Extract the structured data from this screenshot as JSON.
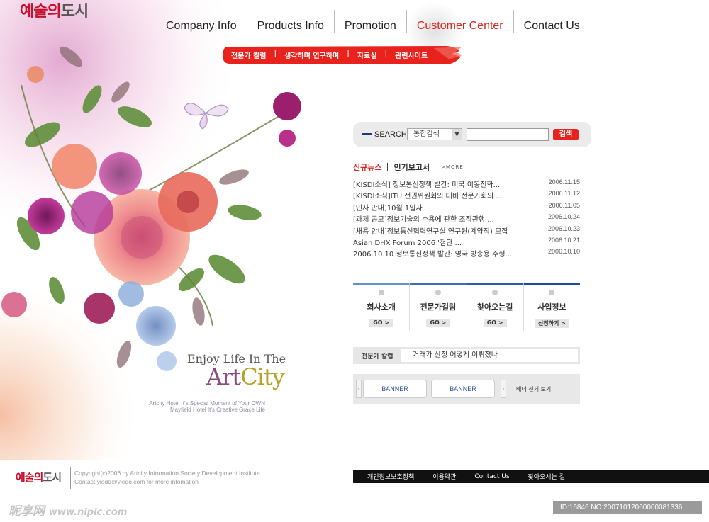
{
  "logo": {
    "part1": "예술의",
    "part2": "도시"
  },
  "nav": {
    "items": [
      {
        "label": "Company Info"
      },
      {
        "label": "Products Info"
      },
      {
        "label": "Promotion"
      },
      {
        "label": "Customer Center"
      },
      {
        "label": "Contact Us"
      }
    ],
    "active_index": 3,
    "active_color": "#d7271f"
  },
  "subnav": {
    "items": [
      "전문가 칼럼",
      "생각하며 연구하며",
      "자료실",
      "관련사이트"
    ],
    "separator": "|",
    "brush_color": "#e8231d"
  },
  "search": {
    "label": "SEARCH",
    "select_value": "통합검색",
    "input_value": "",
    "button_label": "검색"
  },
  "news": {
    "tab_active": "신규뉴스",
    "tab_other": "인기보고서",
    "more_label": ">MORE",
    "items": [
      {
        "title": "[KISDI소식] 정보통신정책 발간: 미국 이동전화...",
        "date": "2006.11.15"
      },
      {
        "title": "[KISDI소식]ITU 전권위원회의 대비 전문가회의 ...",
        "date": "2006.11.12"
      },
      {
        "title": "[인사 안내]10월 1일자",
        "date": "2006.11.05"
      },
      {
        "title": "[과제 공모]정보기술의 수용에 관한 조직관행 ...",
        "date": "2006.10.24"
      },
      {
        "title": "[채용 안내]정보통신협력연구실 연구원(계약직) 모집",
        "date": "2006.10.23"
      },
      {
        "title": "Asian DHX Forum 2006 '첨단 ...",
        "date": "2006.10.21"
      },
      {
        "title": "2006.10.10 정보통신정책 발간: 영국 방송용 주형...",
        "date": "2006.10.10"
      }
    ]
  },
  "tiles": [
    {
      "name": "회사소개",
      "go": "GO >"
    },
    {
      "name": "전문가컬럼",
      "go": "GO >"
    },
    {
      "name": "찾아오는길",
      "go": "GO >"
    },
    {
      "name": "사업정보",
      "go": "신청하기 >"
    }
  ],
  "column": {
    "label": "전문가 칼럼",
    "text": "거래가 산정 어떻게 이뤄졌나"
  },
  "banners": {
    "items": [
      "BANNER",
      "BANNER"
    ],
    "all_label": "배너 전체 보기",
    "prev": "‹",
    "next": "›"
  },
  "art": {
    "enjoy": "Enjoy Life In The",
    "artcity_a": "Art",
    "artcity_c": "City",
    "caption1": "Artcity  Hotel It's Special Moment of Your OWN",
    "caption2": "Mayfield Hotel It's Creative Grace Life"
  },
  "footer": {
    "logo1": "예술의",
    "logo2": "도시",
    "copyright1": "Copyright(c)2006 by Artcity Information Society Development Institute",
    "copyright2": "Contact yiedo@yiedo.com for more infomation",
    "links": [
      "개인정보보호정책",
      "이용약관",
      "Contact Us",
      "찾아오시는 길"
    ]
  },
  "watermark": {
    "site": "昵享网",
    "url": "www.nipic.com",
    "id": "ID:16846 NO:20071012060000081336"
  }
}
